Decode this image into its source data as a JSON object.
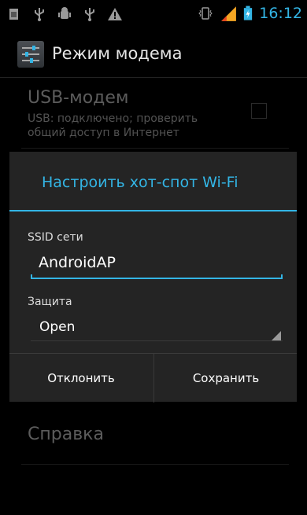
{
  "status_bar": {
    "time": "16:12",
    "icons": [
      "sim-icon",
      "usb-icon",
      "android-debug-icon",
      "usb-icon",
      "warning-icon",
      "vibrate-icon",
      "signal-icon",
      "battery-icon"
    ]
  },
  "action_bar": {
    "title": "Режим модема"
  },
  "prefs": {
    "usb_title": "USB-модем",
    "usb_summary_line1": "USB: подключено; проверить",
    "usb_summary_line2": "общий доступ в Интернет",
    "help_title": "Справка"
  },
  "dialog": {
    "title": "Настроить хот-спот Wi-Fi",
    "ssid_label": "SSID сети",
    "ssid_value": "AndroidAP",
    "security_label": "Защита",
    "security_value": "Open",
    "cancel_label": "Отклонить",
    "save_label": "Сохранить"
  },
  "colors": {
    "accent": "#33b5e5",
    "dialog_bg": "#242424"
  }
}
